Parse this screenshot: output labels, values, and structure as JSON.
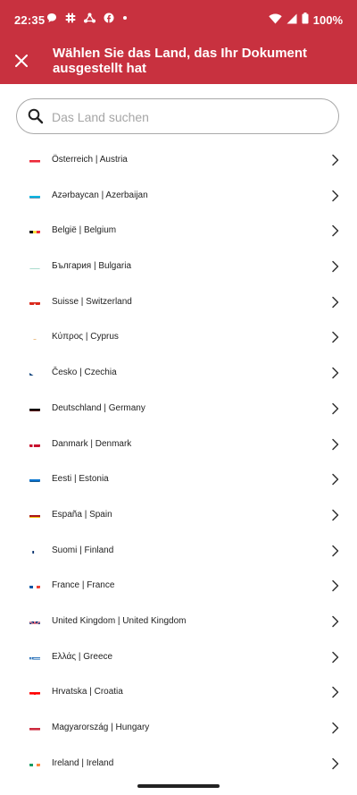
{
  "status_bar": {
    "time": "22:35",
    "battery_text": "100%",
    "notification_icons": [
      "chat-bubble-icon",
      "slack-icon",
      "network-icon",
      "facebook-icon",
      "dot-icon"
    ],
    "status_icons": [
      "wifi-icon",
      "signal-icon",
      "battery-icon"
    ]
  },
  "app_bar": {
    "close_icon": "close-icon",
    "title": "Wählen Sie das Land, das Ihr Dokument ausgestellt hat"
  },
  "search": {
    "placeholder": "Das Land suchen",
    "value": "",
    "icon": "search-icon"
  },
  "countries": [
    {
      "label": "Österreich | Austria",
      "flag": "AT"
    },
    {
      "label": "Azərbaycan | Azerbaijan",
      "flag": "AZ"
    },
    {
      "label": "België | Belgium",
      "flag": "BE"
    },
    {
      "label": "България | Bulgaria",
      "flag": "BG"
    },
    {
      "label": "Suisse | Switzerland",
      "flag": "CH"
    },
    {
      "label": "Κύπρος | Cyprus",
      "flag": "CY"
    },
    {
      "label": "Česko | Czechia",
      "flag": "CZ"
    },
    {
      "label": "Deutschland | Germany",
      "flag": "DE"
    },
    {
      "label": "Danmark | Denmark",
      "flag": "DK"
    },
    {
      "label": "Eesti | Estonia",
      "flag": "EE"
    },
    {
      "label": "España | Spain",
      "flag": "ES"
    },
    {
      "label": "Suomi | Finland",
      "flag": "FI"
    },
    {
      "label": "France | France",
      "flag": "FR"
    },
    {
      "label": "United Kingdom | United Kingdom",
      "flag": "GB"
    },
    {
      "label": "Ελλάς | Greece",
      "flag": "GR"
    },
    {
      "label": "Hrvatska | Croatia",
      "flag": "HR"
    },
    {
      "label": "Magyarország | Hungary",
      "flag": "HU"
    },
    {
      "label": "Ireland | Ireland",
      "flag": "IE"
    }
  ],
  "colors": {
    "brand": "#c8313f",
    "text": "#222222",
    "placeholder": "#a6a6a6",
    "search_border": "#a9a9a9"
  }
}
